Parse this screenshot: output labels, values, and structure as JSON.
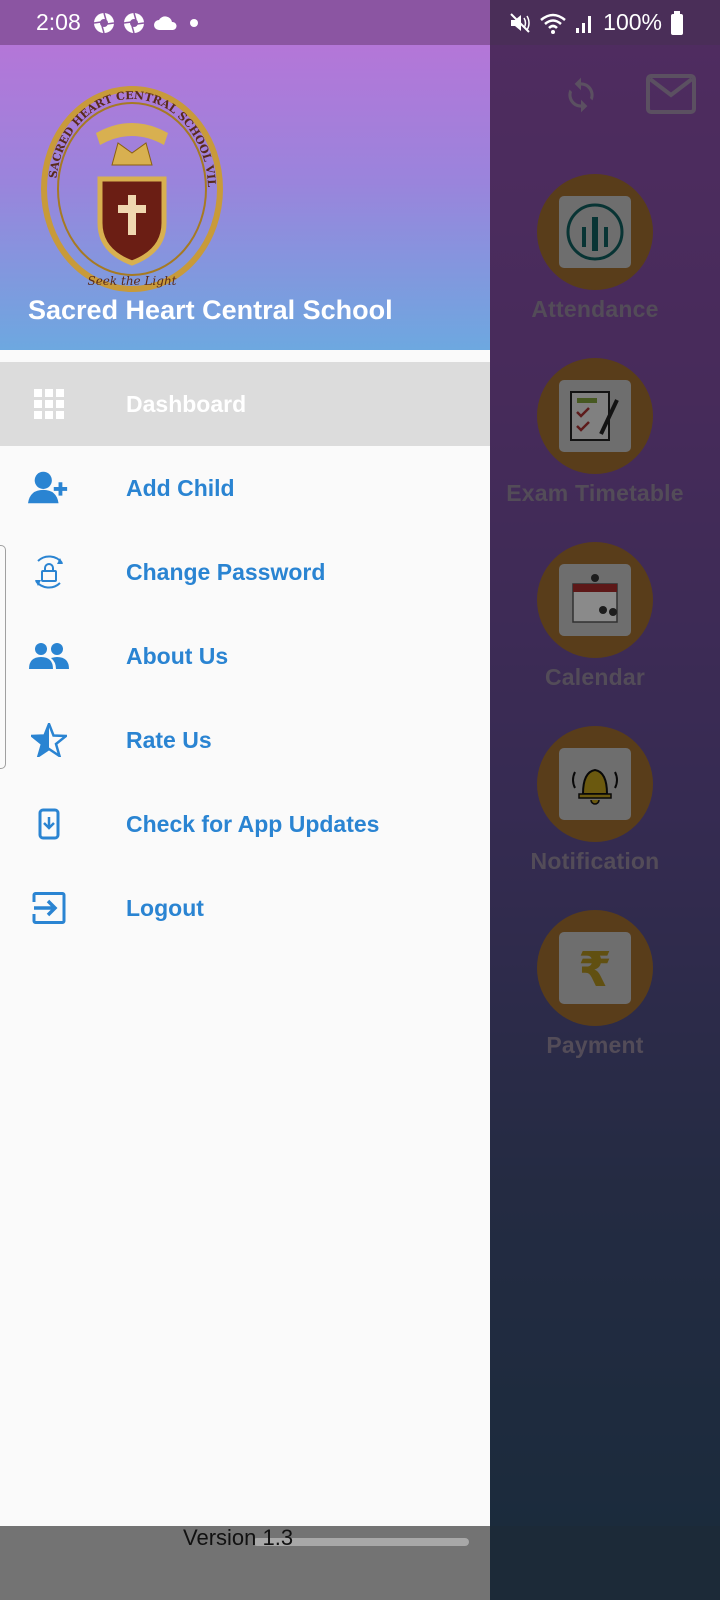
{
  "status_bar": {
    "time": "2:08",
    "battery": "100%",
    "icons": [
      "camera-aperture-icon",
      "camera-aperture-icon",
      "cloud-icon",
      "dot-icon",
      "mute-icon",
      "wifi-icon",
      "signal-icon",
      "battery-icon"
    ]
  },
  "drawer": {
    "school_name": "Sacred Heart Central School",
    "logo": {
      "ring_text": "SACRED HEART CENTRAL SCHOOL VILLUPURAM",
      "motto": "Seek the Light"
    },
    "menu": [
      {
        "label": "Dashboard",
        "icon": "grid-icon",
        "active": true
      },
      {
        "label": "Add Child",
        "icon": "add-person-icon",
        "active": false
      },
      {
        "label": "Change Password",
        "icon": "lock-reset-icon",
        "active": false
      },
      {
        "label": "About Us",
        "icon": "people-icon",
        "active": false
      },
      {
        "label": "Rate Us",
        "icon": "half-star-icon",
        "active": false
      },
      {
        "label": "Check for App Updates",
        "icon": "phone-download-icon",
        "active": false
      },
      {
        "label": "Logout",
        "icon": "logout-icon",
        "active": false
      }
    ],
    "version": "Version 1.3"
  },
  "background_app": {
    "toolbar": {
      "refresh_icon": "refresh-icon",
      "mail_icon": "mail-icon"
    },
    "tiles": [
      {
        "label": "Attendance",
        "icon": "raised-hands-icon"
      },
      {
        "label": "Exam Timetable",
        "icon": "exam-checklist-icon"
      },
      {
        "label": "Calendar",
        "icon": "calendar-icon"
      },
      {
        "label": "Notification",
        "icon": "bell-icon"
      },
      {
        "label": "Payment",
        "icon": "rupee-icon"
      }
    ]
  },
  "colors": {
    "accent": "#2a84d2",
    "active_row": "#dcdcdc",
    "tile_circle": "#9a6a2e"
  }
}
